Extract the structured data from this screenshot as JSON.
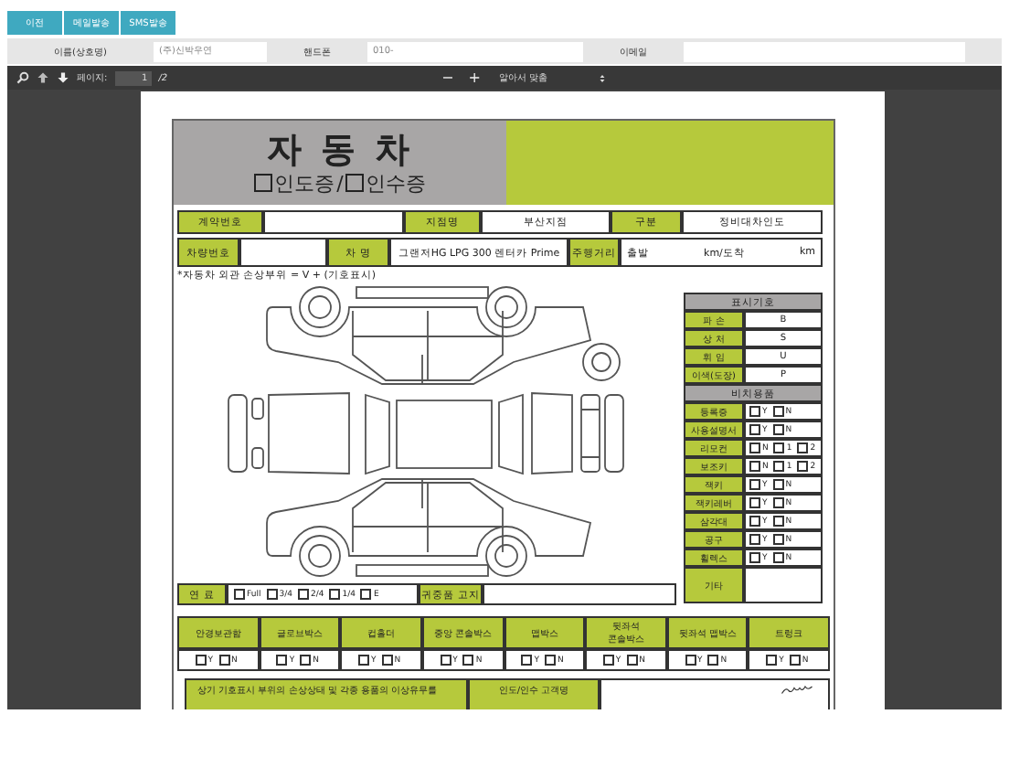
{
  "top_buttons": [
    "이전",
    "메일발송",
    "SMS발송"
  ],
  "customer_fields": [
    {
      "label": "이름(상호명)",
      "placeholder": "(주)신박우연"
    },
    {
      "label": "핸드폰",
      "placeholder": "010-"
    },
    {
      "label": "이메일"
    }
  ],
  "pdf_toolbar": {
    "page_label": "페이지:",
    "page_value": "1",
    "page_total": "/2",
    "zoom_out": "−",
    "zoom_in": "+",
    "zoom_select": "알아서 맞춤"
  },
  "document": {
    "title": "자 동 차",
    "subtitle_options": [
      {
        "label": "인도증",
        "checked": false
      },
      {
        "label": "인수증",
        "checked": false
      }
    ],
    "subtitle_separator": "/",
    "info_row_1": [
      {
        "label": "계약번호"
      },
      {
        "label": "지점명",
        "value": "부산지점"
      },
      {
        "label": "구분",
        "value": "정비대차인도"
      }
    ],
    "info_row_2": [
      {
        "label": "차량번호"
      },
      {
        "label": "차 명",
        "value": "그랜저HG LPG 300 렌터카 Prime"
      },
      {
        "label": "주행거리",
        "value_parts": [
          "출발",
          "km/도착",
          "km"
        ]
      }
    ],
    "damage_note": "*자동차 외관 손상부위 = V + (기호표시)",
    "legend": {
      "title": "표시기호",
      "symbols": [
        {
          "name": "파 손",
          "code": "B"
        },
        {
          "name": "상 처",
          "code": "S"
        },
        {
          "name": "휘 임",
          "code": "U"
        },
        {
          "name": "이색(도장)",
          "code": "P"
        }
      ]
    },
    "supplies": {
      "title": "비치용품",
      "items": [
        {
          "name": "등록증",
          "kind": "checks",
          "options": [
            {
              "label": "Y",
              "checked": false
            },
            {
              "label": "N",
              "checked": false
            }
          ]
        },
        {
          "name": "사용설명서",
          "kind": "checks",
          "options": [
            {
              "label": "Y",
              "checked": false
            },
            {
              "label": "N",
              "checked": false
            }
          ]
        },
        {
          "name": "리모컨",
          "kind": "checks",
          "options": [
            {
              "label": "N",
              "checked": false
            },
            {
              "label": "1",
              "checked": false
            },
            {
              "label": "2",
              "checked": false
            }
          ]
        },
        {
          "name": "보조키",
          "kind": "checks",
          "options": [
            {
              "label": "N",
              "checked": false
            },
            {
              "label": "1",
              "checked": false
            },
            {
              "label": "2",
              "checked": false
            }
          ]
        },
        {
          "name": "잭키",
          "kind": "checks",
          "options": [
            {
              "label": "Y",
              "checked": false
            },
            {
              "label": "N",
              "checked": false
            }
          ]
        },
        {
          "name": "잭키레버",
          "kind": "checks",
          "options": [
            {
              "label": "Y",
              "checked": false
            },
            {
              "label": "N",
              "checked": false
            }
          ]
        },
        {
          "name": "삼각대",
          "kind": "checks",
          "options": [
            {
              "label": "Y",
              "checked": false
            },
            {
              "label": "N",
              "checked": false
            }
          ]
        },
        {
          "name": "공구",
          "kind": "checks",
          "options": [
            {
              "label": "Y",
              "checked": false
            },
            {
              "label": "N",
              "checked": false
            }
          ]
        },
        {
          "name": "휠렉스",
          "kind": "checks",
          "options": [
            {
              "label": "Y",
              "checked": false
            },
            {
              "label": "N",
              "checked": false
            }
          ]
        },
        {
          "name": "기타",
          "kind": "text"
        }
      ]
    },
    "fuel": {
      "label": "연 료",
      "options": [
        {
          "label": "Full",
          "checked": false
        },
        {
          "label": "3/4",
          "checked": false
        },
        {
          "label": "2/4",
          "checked": false
        },
        {
          "label": "1/4",
          "checked": false
        },
        {
          "label": "E",
          "checked": false
        }
      ],
      "valuables_label": "귀중품 고지"
    },
    "interior_items": [
      {
        "name": "안경보관함",
        "options": [
          {
            "label": "Y",
            "checked": false
          },
          {
            "label": "N",
            "checked": false
          }
        ]
      },
      {
        "name": "글로브박스",
        "options": [
          {
            "label": "Y",
            "checked": false
          },
          {
            "label": "N",
            "checked": false
          }
        ]
      },
      {
        "name": "컵홀더",
        "options": [
          {
            "label": "Y",
            "checked": false
          },
          {
            "label": "N",
            "checked": false
          }
        ]
      },
      {
        "name": "중앙 콘솔박스",
        "options": [
          {
            "label": "Y",
            "checked": false
          },
          {
            "label": "N",
            "checked": false
          }
        ]
      },
      {
        "name": "맵박스",
        "options": [
          {
            "label": "Y",
            "checked": false
          },
          {
            "label": "N",
            "checked": false
          }
        ]
      },
      {
        "name": "뒷좌석 콘솔박스",
        "options": [
          {
            "label": "Y",
            "checked": false
          },
          {
            "label": "N",
            "checked": false
          }
        ]
      },
      {
        "name": "뒷좌석 맵박스",
        "options": [
          {
            "label": "Y",
            "checked": false
          },
          {
            "label": "N",
            "checked": false
          }
        ]
      },
      {
        "name": "트렁크",
        "options": [
          {
            "label": "Y",
            "checked": false
          },
          {
            "label": "N",
            "checked": false
          }
        ]
      }
    ],
    "confirmation": {
      "text": "상기 기호표시 부위의 손상상태 및 각종 용품의 이상유무를",
      "customer_label": "인도/인수 고객명"
    }
  }
}
